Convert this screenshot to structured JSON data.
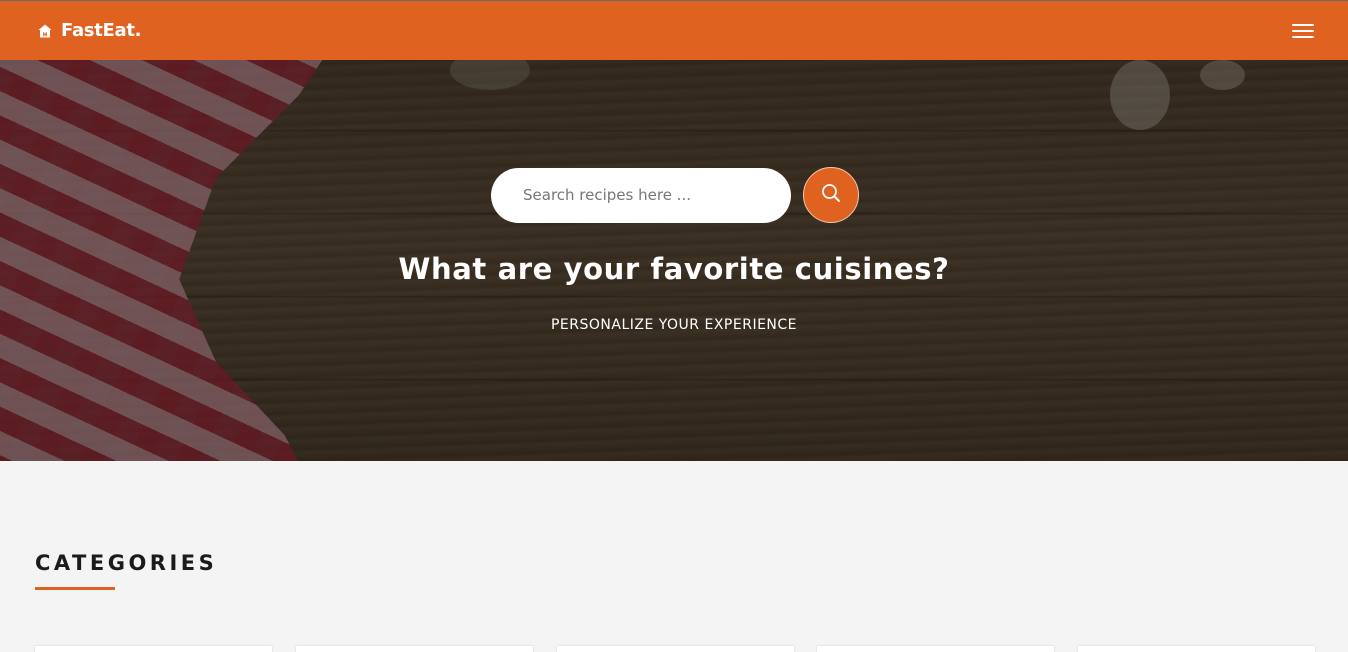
{
  "navbar": {
    "brand": "FastEat.",
    "brand_icon": "home-icon",
    "menu_icon": "hamburger-menu-icon",
    "accent_color": "#e06220"
  },
  "hero": {
    "search": {
      "placeholder": "Search recipes here ...",
      "value": "",
      "button_icon": "search-icon"
    },
    "title": "What are your favorite cuisines?",
    "subtitle": "PERSONALIZE YOUR EXPERIENCE"
  },
  "categories": {
    "heading": "CATEGORIES",
    "card_count": 5
  }
}
